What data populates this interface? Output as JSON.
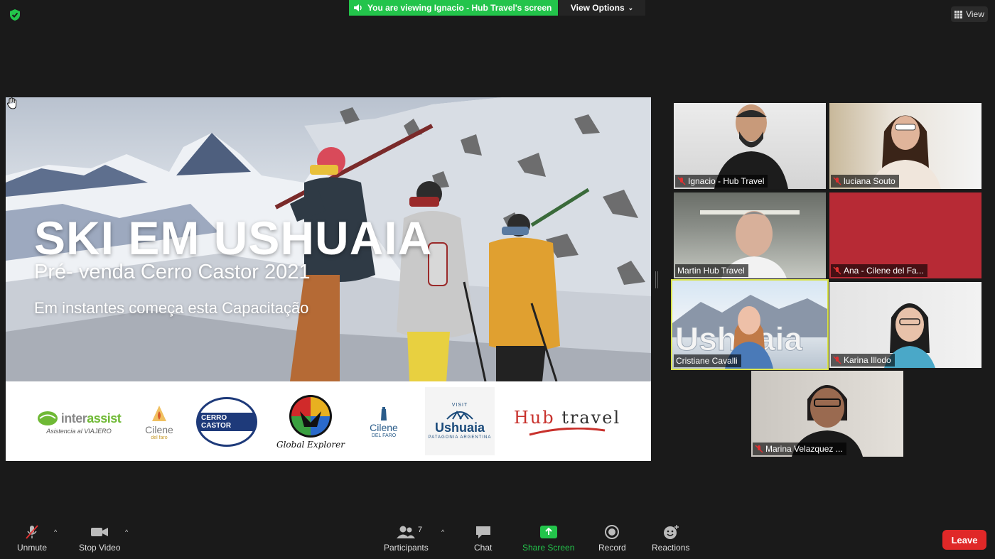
{
  "topbar": {
    "viewing_text": "You are viewing Ignacio - Hub Travel's screen",
    "view_options_label": "View Options",
    "view_label": "View"
  },
  "slide": {
    "title": "SKI EM USHUAIA",
    "subtitle": "Pré- venda Cerro Castor 2021",
    "subtitle2": "Em instantes começa esta Capacitação",
    "logos": {
      "interassist_a": "inter",
      "interassist_b": "assist",
      "interassist_tag": "Asistencia al VIAJERO",
      "cilene1": "Cilene",
      "cilene1_tag": "del faro",
      "castor": "CERRO CASTOR",
      "global_explorer": "Global Explorer",
      "cilene2": "Cilene",
      "cilene2_tag": "DEL FARO",
      "ushuaia_visit": "VISIT",
      "ushuaia": "Ushuaia",
      "ushuaia_tag": "PATAGONIA ARGENTINA",
      "hub_a": "Hub",
      "hub_b": " travel"
    }
  },
  "participants": [
    {
      "name": "Ignacio - Hub Travel",
      "muted": true
    },
    {
      "name": "luciana Souto",
      "muted": true
    },
    {
      "name": "Martin Hub Travel",
      "muted": false
    },
    {
      "name": "Ana - Cilene del Fa...",
      "muted": true
    },
    {
      "name": "Cristiane Cavalli",
      "muted": false,
      "active": true
    },
    {
      "name": "Karina Illodo",
      "muted": true
    },
    {
      "name": "Marina Velazquez ...",
      "muted": true
    }
  ],
  "toolbar": {
    "unmute": "Unmute",
    "stop_video": "Stop Video",
    "participants": "Participants",
    "participants_count": "7",
    "chat": "Chat",
    "share_screen": "Share Screen",
    "record": "Record",
    "reactions": "Reactions",
    "leave": "Leave"
  },
  "colors": {
    "share_green": "#23c44b",
    "leave_red": "#e02828",
    "active_speaker": "#d9e24a"
  }
}
